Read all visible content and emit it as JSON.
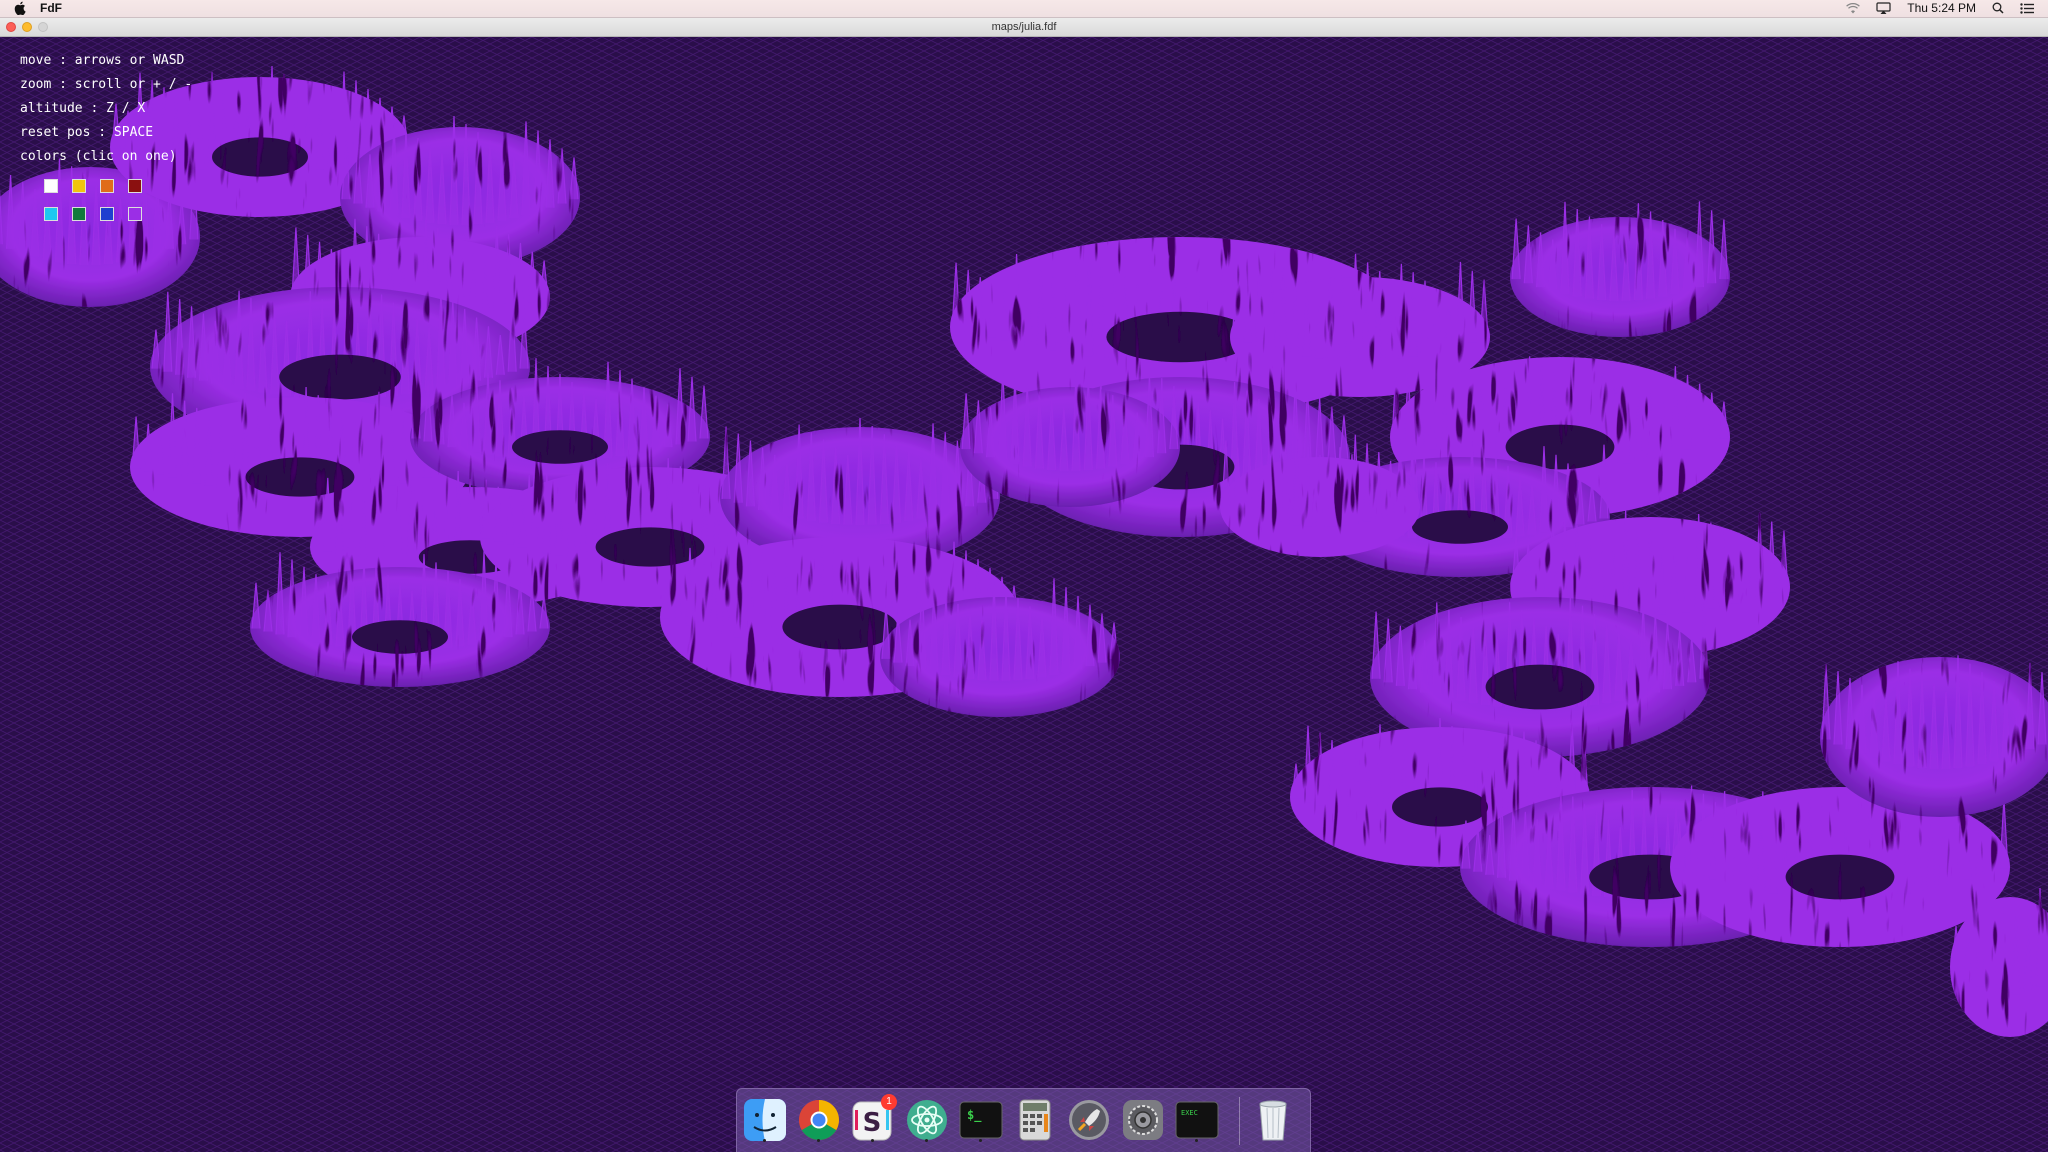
{
  "menubar": {
    "app_name": "FdF",
    "clock": "Thu 5:24 PM"
  },
  "window": {
    "title": "maps/julia.fdf"
  },
  "hud": {
    "move": "move : arrows or WASD",
    "zoom": "zoom : scroll or + / -",
    "altitude": "altitude : Z / X",
    "reset": "reset pos : SPACE",
    "colors": "colors (clic on one)"
  },
  "palette": [
    "#ffffff",
    "#f1c40f",
    "#e06c1a",
    "#8b1010",
    "#1ec8f0",
    "#127a3c",
    "#1f3fcf",
    "#9b2ee6"
  ],
  "colors": {
    "background": "#2a0e4a",
    "wireframe": "#9b2ee6"
  },
  "dock": {
    "items": [
      "finder-icon",
      "chrome-icon",
      "slack-icon",
      "atom-icon",
      "terminal-icon",
      "calculator-icon",
      "launchpad-icon",
      "system-preferences-icon",
      "exec-icon",
      "trash-icon"
    ],
    "slack_badge": "1",
    "terminal_glyph": "$_",
    "exec_label": "exec"
  }
}
